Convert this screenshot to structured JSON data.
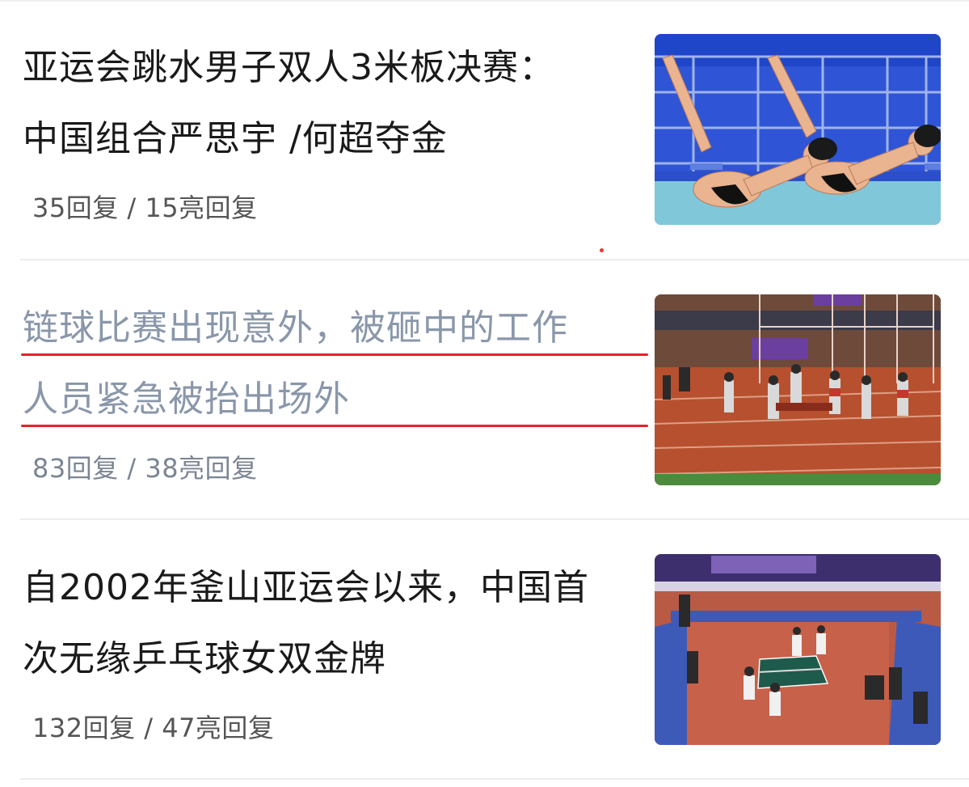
{
  "articles": [
    {
      "title_lines": [
        "亚运会跳水男子双人3米板决赛：",
        "中国组合严思宇 /何超夺金"
      ],
      "meta": "35回复 / 15亮回复",
      "thumbnail_icon": "diving-photo"
    },
    {
      "title_lines": [
        "链球比赛出现意外，被砸中的工作",
        "人员紧急被抬出场外"
      ],
      "meta": "83回复 / 38亮回复",
      "thumbnail_icon": "hammer-throw-track-photo"
    },
    {
      "title_lines": [
        "自2002年釜山亚运会以来，中国首",
        "次无缘乒乓球女双金牌"
      ],
      "meta": "132回复 / 47亮回复",
      "thumbnail_icon": "table-tennis-photo"
    }
  ],
  "colors": {
    "title_text": "#1a1a1a",
    "visited_title_text": "#8a97aa",
    "annotation_underline": "#e8202a",
    "meta_text": "#555555"
  }
}
